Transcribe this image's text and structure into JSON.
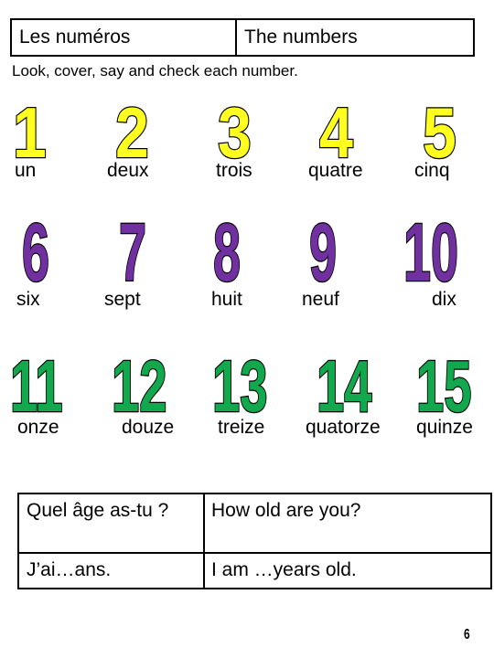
{
  "header": {
    "french": "Les numéros",
    "english": "The numbers"
  },
  "instruction": "Look, cover, say and check each number.",
  "colors": {
    "row1": "#ffff1f",
    "row2": "#7030a0",
    "row3": "#12a84e",
    "outline": "#000000"
  },
  "numbers": [
    {
      "digit": "1",
      "word": "un"
    },
    {
      "digit": "2",
      "word": "deux"
    },
    {
      "digit": "3",
      "word": "trois"
    },
    {
      "digit": "4",
      "word": "quatre"
    },
    {
      "digit": "5",
      "word": "cinq"
    },
    {
      "digit": "6",
      "word": "six"
    },
    {
      "digit": "7",
      "word": "sept"
    },
    {
      "digit": "8",
      "word": "huit"
    },
    {
      "digit": "9",
      "word": "neuf"
    },
    {
      "digit": "10",
      "word": "dix"
    },
    {
      "digit": "11",
      "word": "onze"
    },
    {
      "digit": "12",
      "word": "douze"
    },
    {
      "digit": "13",
      "word": "treize"
    },
    {
      "digit": "14",
      "word": "quatorze"
    },
    {
      "digit": "15",
      "word": "quinze"
    }
  ],
  "phrases": [
    {
      "french": "Quel âge as-tu ?",
      "english": "How old are you?"
    },
    {
      "french": "J’ai…ans.",
      "english": "I am …years old."
    }
  ],
  "page_number": "6"
}
